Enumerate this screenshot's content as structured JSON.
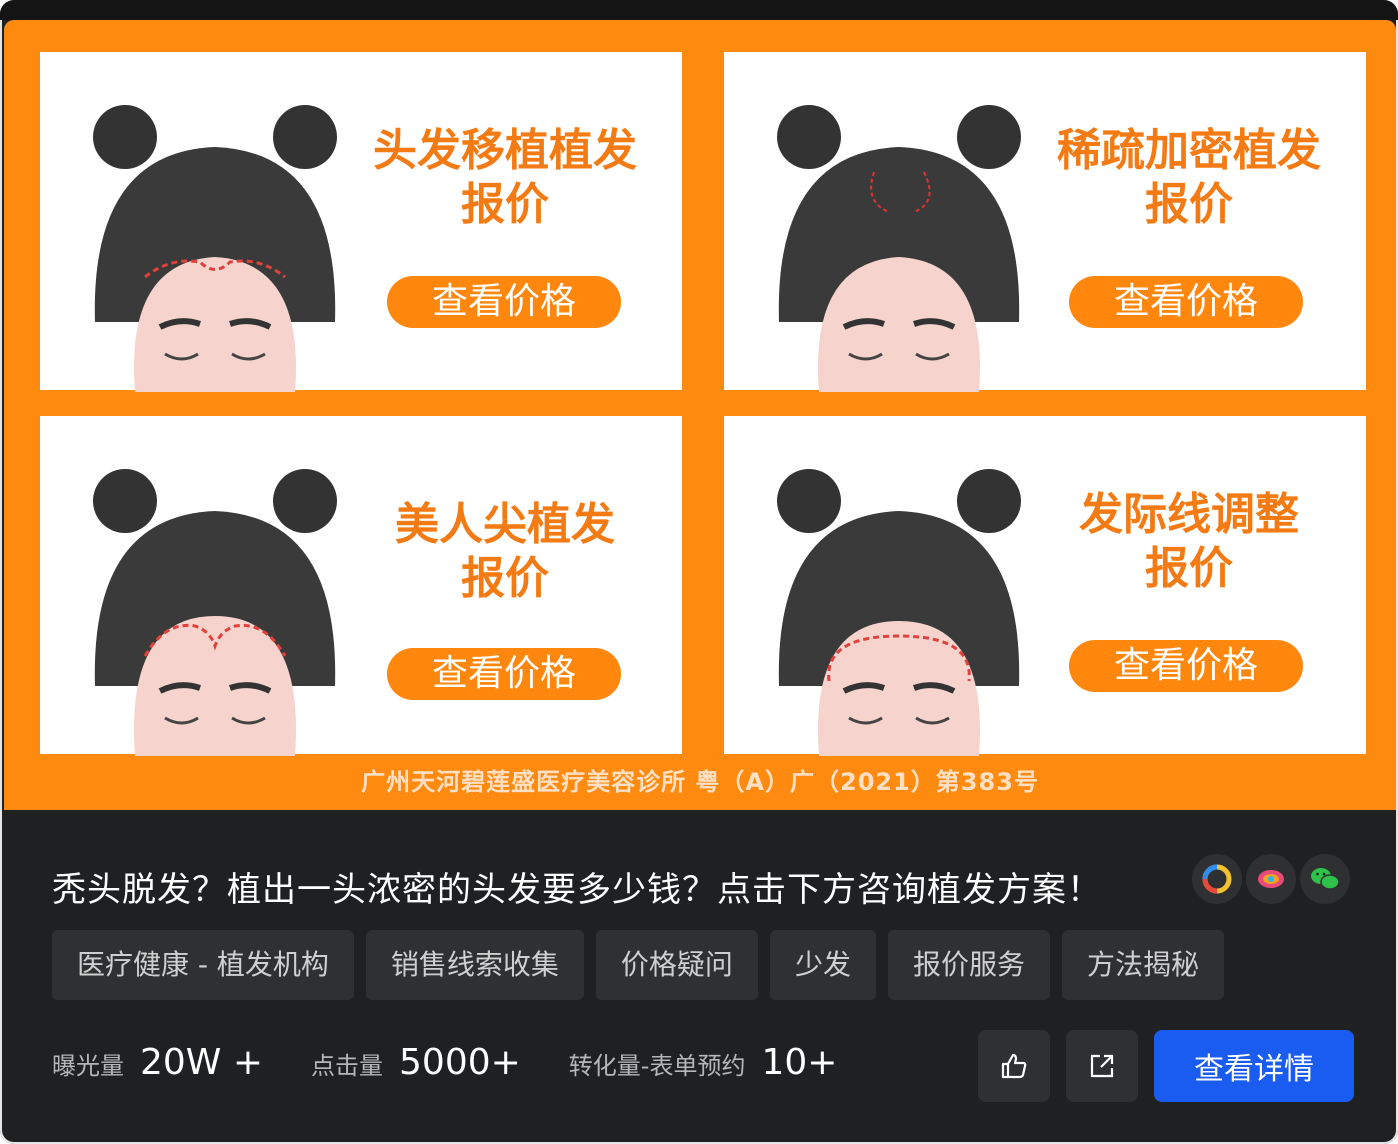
{
  "banner": {
    "cards": [
      {
        "title_line1": "头发移植植发",
        "title_line2": "报价",
        "button": "查看价格"
      },
      {
        "title_line1": "稀疏加密植发",
        "title_line2": "报价",
        "button": "查看价格"
      },
      {
        "title_line1": "美人尖植发",
        "title_line2": "报价",
        "button": "查看价格"
      },
      {
        "title_line1": "发际线调整",
        "title_line2": "报价",
        "button": "查看价格"
      }
    ],
    "license": "广州天河碧莲盛医疗美容诊所 粤（A）广（2021）第383号"
  },
  "ad": {
    "headline": "秃头脱发？植出一头浓密的头发要多少钱？点击下方咨询植发方案！",
    "platforms": [
      "qq-browser-icon",
      "tencent-video-icon",
      "wechat-icon"
    ],
    "tags": [
      "医疗健康 - 植发机构",
      "销售线索收集",
      "价格疑问",
      "少发",
      "报价服务",
      "方法揭秘"
    ],
    "stats": [
      {
        "label": "曝光量",
        "value": "20W +"
      },
      {
        "label": "点击量",
        "value": "5000+"
      },
      {
        "label": "转化量-表单预约",
        "value": "10+"
      }
    ],
    "detail_button": "查看详情"
  },
  "colors": {
    "orange": "#ff8a10",
    "title_orange": "#f47a13",
    "primary_blue": "#1a5cf0",
    "panel": "#1f2022"
  }
}
